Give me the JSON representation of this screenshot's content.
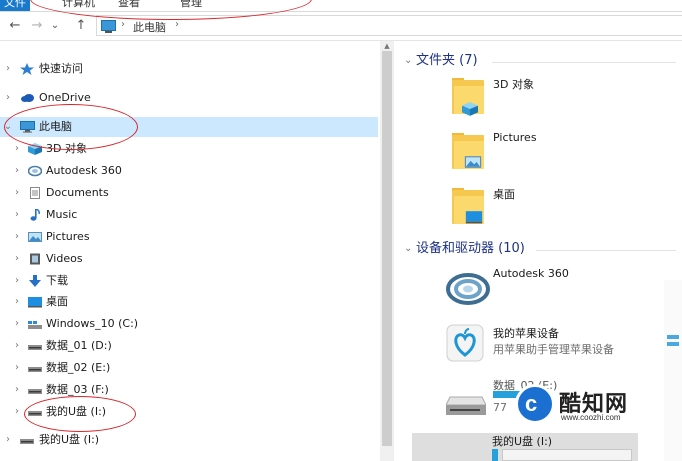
{
  "ribbon": {
    "tabs": [
      "文件",
      "计算机",
      "查看",
      "管理"
    ]
  },
  "toolbar": {
    "back_icon": "←",
    "forward_icon": "→",
    "recent_icon": "⌄",
    "up_icon": "↑",
    "crumbs": [
      "此电脑"
    ],
    "sep": "›"
  },
  "nav": {
    "items": [
      {
        "label": "快速访问",
        "icon": "star-icon",
        "chev": "›"
      },
      {
        "label": "OneDrive",
        "icon": "cloud-icon",
        "chev": "›"
      },
      {
        "label": "此电脑",
        "icon": "computer-icon",
        "chev": "⌄"
      },
      {
        "label": "3D 对象",
        "icon": "cube-icon",
        "chev": "›"
      },
      {
        "label": "Autodesk 360",
        "icon": "autodesk-icon",
        "chev": "›"
      },
      {
        "label": "Documents",
        "icon": "document-icon",
        "chev": "›"
      },
      {
        "label": "Music",
        "icon": "music-icon",
        "chev": "›"
      },
      {
        "label": "Pictures",
        "icon": "pictures-icon",
        "chev": "›"
      },
      {
        "label": "Videos",
        "icon": "video-icon",
        "chev": "›"
      },
      {
        "label": "下载",
        "icon": "download-icon",
        "chev": "›"
      },
      {
        "label": "桌面",
        "icon": "desktop-icon",
        "chev": "›"
      },
      {
        "label": "Windows_10 (C:)",
        "icon": "windows-drive-icon",
        "chev": "›"
      },
      {
        "label": "数据_01 (D:)",
        "icon": "drive-icon",
        "chev": "›"
      },
      {
        "label": "数据_02 (E:)",
        "icon": "drive-icon",
        "chev": "›"
      },
      {
        "label": "数据_03 (F:)",
        "icon": "drive-icon",
        "chev": "›"
      },
      {
        "label": "我的U盘 (I:)",
        "icon": "usb-drive-icon",
        "chev": "›"
      },
      {
        "label": "我的U盘 (I:)",
        "icon": "usb-drive-icon",
        "chev": "›"
      }
    ]
  },
  "content": {
    "folders_header": "文件夹 (7)",
    "folders": [
      {
        "label": "3D 对象"
      },
      {
        "label": "Pictures"
      },
      {
        "label": "桌面"
      }
    ],
    "devices_header": "设备和驱动器 (10)",
    "devices": [
      {
        "label": "Autodesk 360",
        "sub": ""
      },
      {
        "label": "我的苹果设备",
        "sub": "用苹果助手管理苹果设备"
      },
      {
        "label": "数据_02 (E:)",
        "sub": "77"
      },
      {
        "label": "我的U盘 (I:)",
        "sub": ""
      }
    ]
  },
  "watermark": {
    "mark": "c",
    "name": "酷知网",
    "url": "www.coozhi.com"
  },
  "colors": {
    "selected": "#cce8ff",
    "accent": "#1979ca",
    "header": "#1e3287",
    "annotation": "#d7262b"
  }
}
